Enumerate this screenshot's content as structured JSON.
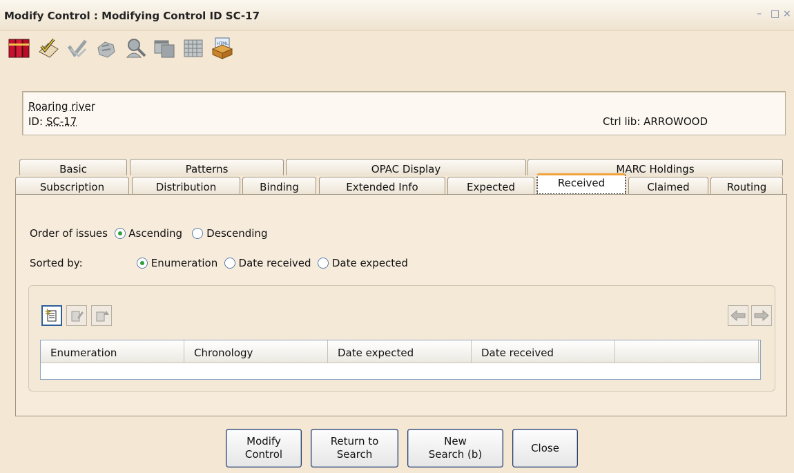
{
  "window": {
    "title": "Modify Control : Modifying Control ID SC-17",
    "minimize": "–",
    "maximize": "□",
    "close": "×"
  },
  "toolbar": {
    "icons": [
      "books-icon",
      "checklist-icon",
      "check-icon",
      "hand-icon",
      "search-person-icon",
      "window-icon",
      "grid-icon",
      "html-box-icon"
    ]
  },
  "info": {
    "title": "Roaring river",
    "id_label": "ID:",
    "id_value": "SC-17",
    "ctrl_lib": "Ctrl lib: ARROWOOD"
  },
  "tabs": {
    "row1": [
      "Basic",
      "Patterns",
      "OPAC Display",
      "MARC Holdings"
    ],
    "row2": [
      "Subscription",
      "Distribution",
      "Binding",
      "Extended Info",
      "Expected",
      "Received",
      "Claimed",
      "Routing"
    ],
    "active": "Received"
  },
  "received": {
    "order_label": "Order of issues",
    "order_options": [
      "Ascending",
      "Descending"
    ],
    "order_selected": "Ascending",
    "sorted_label": "Sorted by:",
    "sorted_options": [
      "Enumeration",
      "Date received",
      "Date expected"
    ],
    "sorted_selected": "Enumeration",
    "columns": [
      "Enumeration",
      "Chronology",
      "Date expected",
      "Date received"
    ]
  },
  "buttons": {
    "modify": "Modify\nControl",
    "return": "Return to\nSearch",
    "new_search": "New\nSearch (b)",
    "close": "Close"
  },
  "colors": {
    "background": "#f4e7d3",
    "active_tab_accent": "#f2a23a",
    "radio_selected": "#2f9f3a"
  }
}
